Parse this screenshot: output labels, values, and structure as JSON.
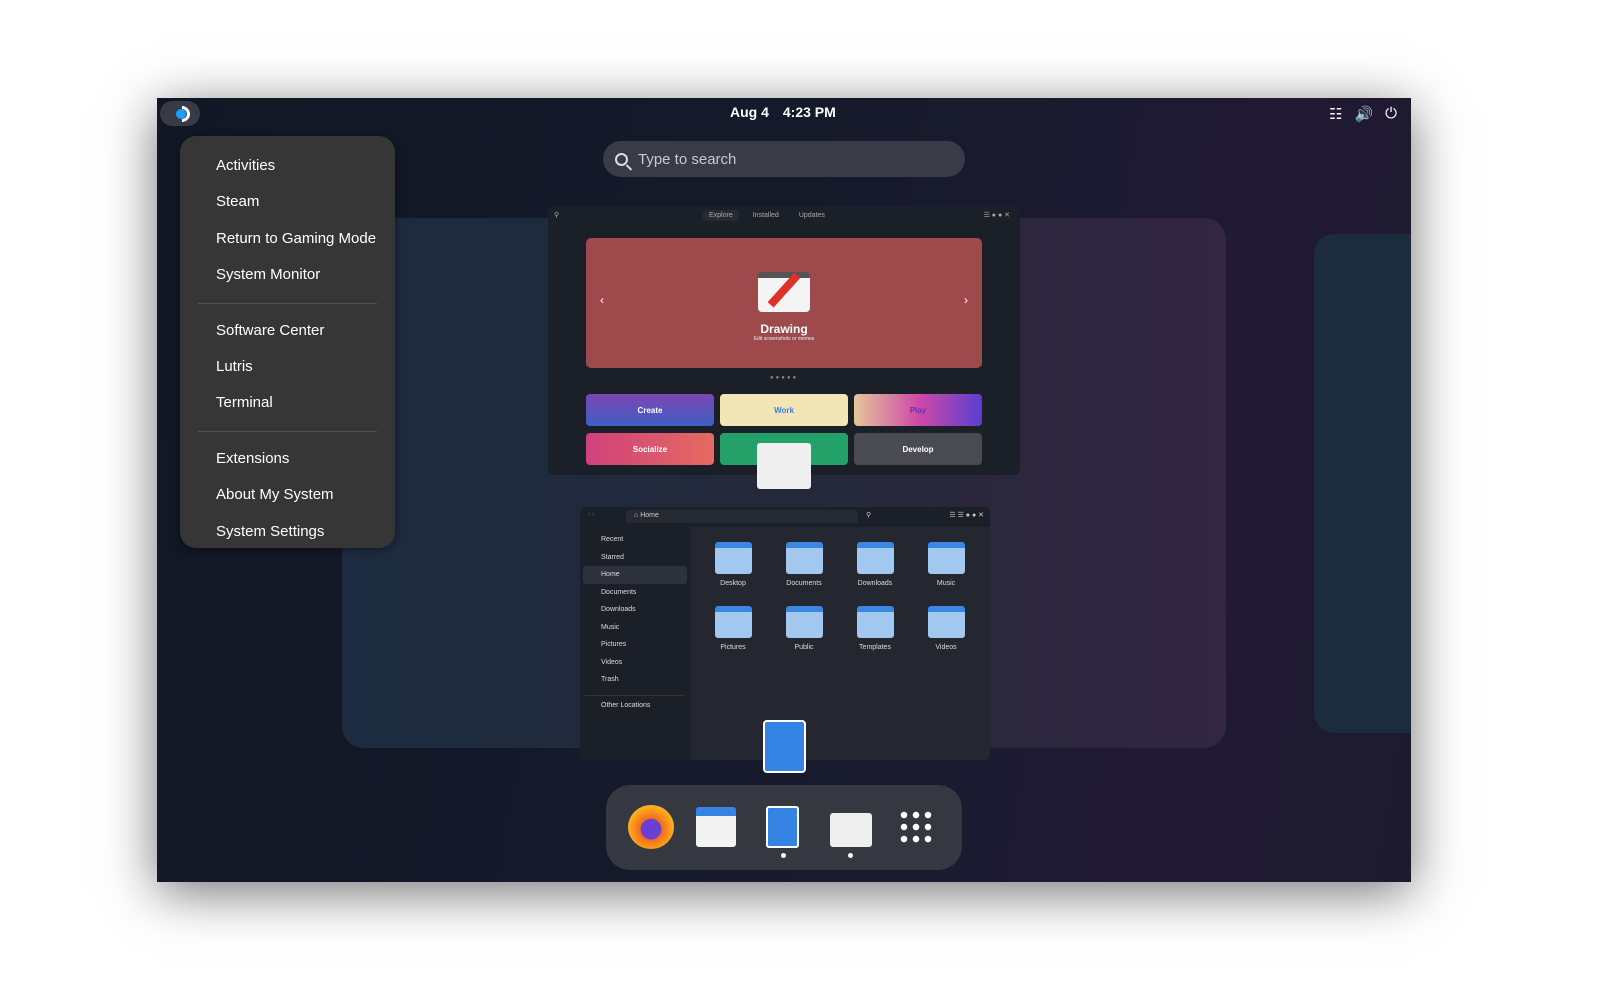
{
  "topbar": {
    "date": "Aug 4",
    "time": "4:23 PM",
    "icons": [
      "steam-logo-icon",
      "network-icon",
      "volume-icon",
      "power-icon"
    ]
  },
  "search": {
    "placeholder": "Type to search"
  },
  "menu": {
    "groups": [
      [
        "Activities",
        "Steam",
        "Return to Gaming Mode",
        "System Monitor"
      ],
      [
        "Software Center",
        "Lutris",
        "Terminal"
      ],
      [
        "Extensions",
        "About My System",
        "System Settings"
      ]
    ]
  },
  "software": {
    "tabs": [
      "Explore",
      "Installed",
      "Updates"
    ],
    "featured": {
      "title": "Drawing",
      "subtitle": "Edit screenshots or memes"
    },
    "categories": [
      "Create",
      "Work",
      "Play",
      "Socialize",
      "",
      "Develop"
    ]
  },
  "files": {
    "path": "Home",
    "sidebar": [
      "Recent",
      "Starred",
      "Home",
      "Documents",
      "Downloads",
      "Music",
      "Pictures",
      "Videos",
      "Trash"
    ],
    "other": "Other Locations",
    "folders": [
      "Desktop",
      "Documents",
      "Downloads",
      "Music",
      "Pictures",
      "Public",
      "Templates",
      "Videos"
    ]
  },
  "dock": {
    "apps": [
      "firefox-icon",
      "calendar-icon",
      "files-icon",
      "software-icon",
      "app-grid-icon"
    ]
  },
  "colors": {
    "accent": "#3584e4",
    "steam": "#1a9fff"
  }
}
